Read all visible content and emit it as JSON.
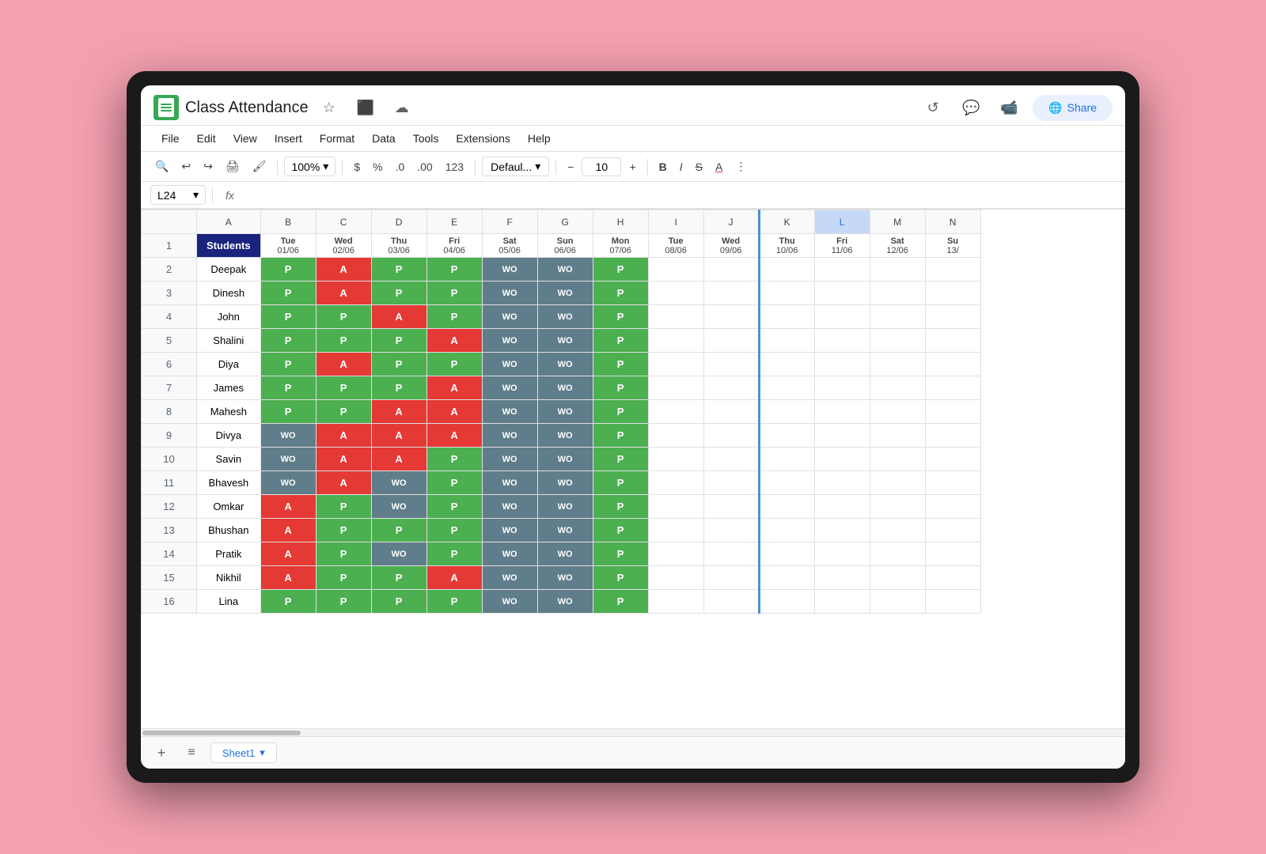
{
  "app": {
    "title": "Class Attendance",
    "share_label": "Share"
  },
  "menu": {
    "items": [
      "File",
      "Edit",
      "View",
      "Insert",
      "Format",
      "Data",
      "Tools",
      "Extensions",
      "Help"
    ]
  },
  "toolbar": {
    "zoom": "100%",
    "currency": "$",
    "percent": "%",
    "decimal_less": ".0",
    "decimal_more": ".00",
    "format_123": "123",
    "font_family": "Defaul...",
    "font_size": "10"
  },
  "formula_bar": {
    "cell_ref": "L24",
    "fx": "fx"
  },
  "columns": {
    "header_row": [
      "",
      "A",
      "B",
      "C",
      "D",
      "E",
      "F",
      "G",
      "H",
      "I",
      "J",
      "K",
      "L",
      "M",
      "N"
    ],
    "col_A_label": "Students",
    "dates": [
      {
        "day": "Tue",
        "date": "01/06"
      },
      {
        "day": "Wed",
        "date": "02/06"
      },
      {
        "day": "Thu",
        "date": "03/06"
      },
      {
        "day": "Fri",
        "date": "04/06"
      },
      {
        "day": "Sat",
        "date": "05/06"
      },
      {
        "day": "Sun",
        "date": "06/06"
      },
      {
        "day": "Mon",
        "date": "07/06"
      },
      {
        "day": "Tue",
        "date": "08/06"
      },
      {
        "day": "Wed",
        "date": "09/06"
      },
      {
        "day": "Thu",
        "date": "10/06"
      },
      {
        "day": "Fri",
        "date": "11/06"
      },
      {
        "day": "Sat",
        "date": "12/06"
      },
      {
        "day": "Su",
        "date": "13/"
      }
    ]
  },
  "rows": [
    {
      "name": "Deepak",
      "data": [
        "P",
        "A",
        "P",
        "P",
        "WO",
        "WO",
        "P",
        "",
        "",
        "",
        "",
        "",
        ""
      ]
    },
    {
      "name": "Dinesh",
      "data": [
        "P",
        "A",
        "P",
        "P",
        "WO",
        "WO",
        "P",
        "",
        "",
        "",
        "",
        "",
        ""
      ]
    },
    {
      "name": "John",
      "data": [
        "P",
        "P",
        "A",
        "P",
        "WO",
        "WO",
        "P",
        "",
        "",
        "",
        "",
        "",
        ""
      ]
    },
    {
      "name": "Shalini",
      "data": [
        "P",
        "P",
        "P",
        "A",
        "WO",
        "WO",
        "P",
        "",
        "",
        "",
        "",
        "",
        ""
      ]
    },
    {
      "name": "Diya",
      "data": [
        "P",
        "A",
        "P",
        "P",
        "WO",
        "WO",
        "P",
        "",
        "",
        "",
        "",
        "",
        ""
      ]
    },
    {
      "name": "James",
      "data": [
        "P",
        "P",
        "P",
        "A",
        "WO",
        "WO",
        "P",
        "",
        "",
        "",
        "",
        "",
        ""
      ]
    },
    {
      "name": "Mahesh",
      "data": [
        "P",
        "P",
        "A",
        "A",
        "WO",
        "WO",
        "P",
        "",
        "",
        "",
        "",
        "",
        ""
      ]
    },
    {
      "name": "Divya",
      "data": [
        "WO",
        "A",
        "A",
        "A",
        "WO",
        "WO",
        "P",
        "",
        "",
        "",
        "",
        "",
        ""
      ]
    },
    {
      "name": "Savin",
      "data": [
        "WO",
        "A",
        "A",
        "P",
        "WO",
        "WO",
        "P",
        "",
        "",
        "",
        "",
        "",
        ""
      ]
    },
    {
      "name": "Bhavesh",
      "data": [
        "WO",
        "A",
        "WO",
        "P",
        "WO",
        "WO",
        "P",
        "",
        "",
        "",
        "",
        "",
        ""
      ]
    },
    {
      "name": "Omkar",
      "data": [
        "A",
        "P",
        "WO",
        "P",
        "WO",
        "WO",
        "P",
        "",
        "",
        "",
        "",
        "",
        ""
      ]
    },
    {
      "name": "Bhushan",
      "data": [
        "A",
        "P",
        "P",
        "P",
        "WO",
        "WO",
        "P",
        "",
        "",
        "",
        "",
        "",
        ""
      ]
    },
    {
      "name": "Pratik",
      "data": [
        "A",
        "P",
        "WO",
        "P",
        "WO",
        "WO",
        "P",
        "",
        "",
        "",
        "",
        "",
        ""
      ]
    },
    {
      "name": "Nikhil",
      "data": [
        "A",
        "P",
        "P",
        "A",
        "WO",
        "WO",
        "P",
        "",
        "",
        "",
        "",
        "",
        ""
      ]
    },
    {
      "name": "Lina",
      "data": [
        "P",
        "P",
        "P",
        "P",
        "WO",
        "WO",
        "P",
        "",
        "",
        "",
        "",
        "",
        ""
      ]
    }
  ],
  "sheet": {
    "tab_label": "Sheet1",
    "add_label": "+",
    "menu_label": "≡"
  }
}
